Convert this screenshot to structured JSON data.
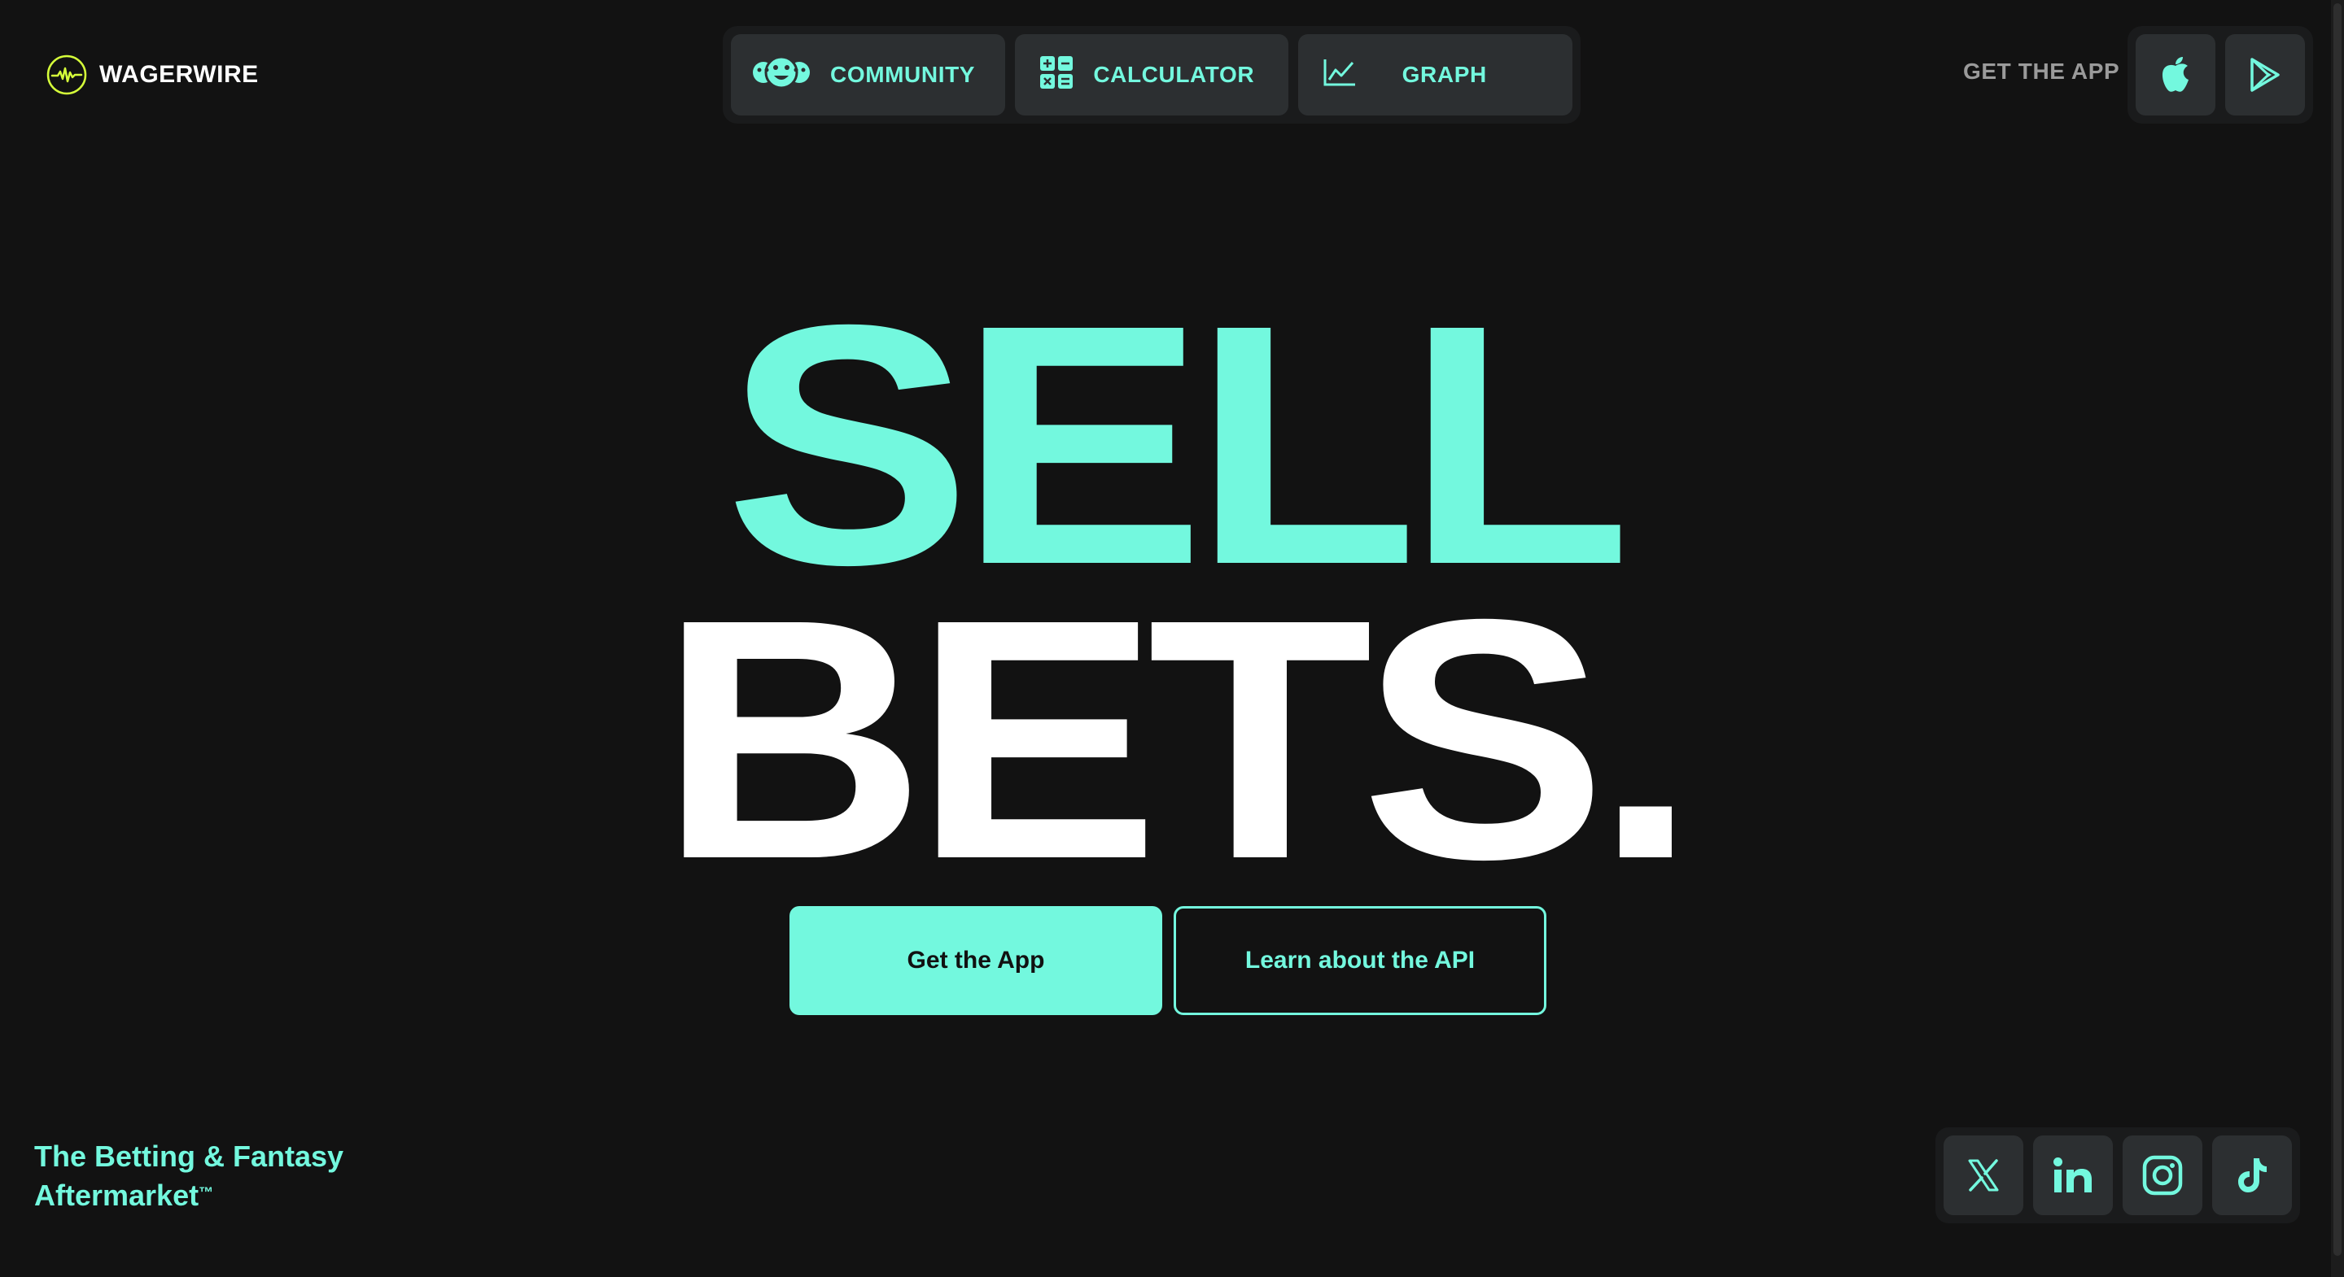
{
  "brand": {
    "name": "WAGERWIRE",
    "logo_icon": "pulse-circle-icon",
    "logo_ring_color": "#d6ff3a",
    "accent_color": "#73f8de"
  },
  "nav": {
    "items": [
      {
        "label": "COMMUNITY",
        "icon": "community-faces-icon"
      },
      {
        "label": "CALCULATOR",
        "icon": "calculator-icon"
      },
      {
        "label": "GRAPH",
        "icon": "line-chart-icon"
      }
    ]
  },
  "header": {
    "get_app_label": "GET THE APP",
    "stores": [
      {
        "name": "App Store",
        "icon": "apple-icon"
      },
      {
        "name": "Google Play",
        "icon": "google-play-icon"
      }
    ]
  },
  "hero": {
    "line1": "SELL",
    "line2": "BETS.",
    "primary_cta": "Get the App",
    "secondary_cta": "Learn about the API"
  },
  "footer": {
    "tagline_line1": "The Betting & Fantasy",
    "tagline_line2": "Aftermarket",
    "trademark": "™",
    "social": [
      {
        "name": "X",
        "icon": "x-icon"
      },
      {
        "name": "LinkedIn",
        "icon": "linkedin-icon"
      },
      {
        "name": "Instagram",
        "icon": "instagram-icon"
      },
      {
        "name": "TikTok",
        "icon": "tiktok-icon"
      }
    ]
  },
  "colors": {
    "background": "#121212",
    "panel": "#1a1b1c",
    "button": "#2c2f31",
    "hero_white": "#ffffff",
    "muted_text": "#9a9a9a"
  }
}
